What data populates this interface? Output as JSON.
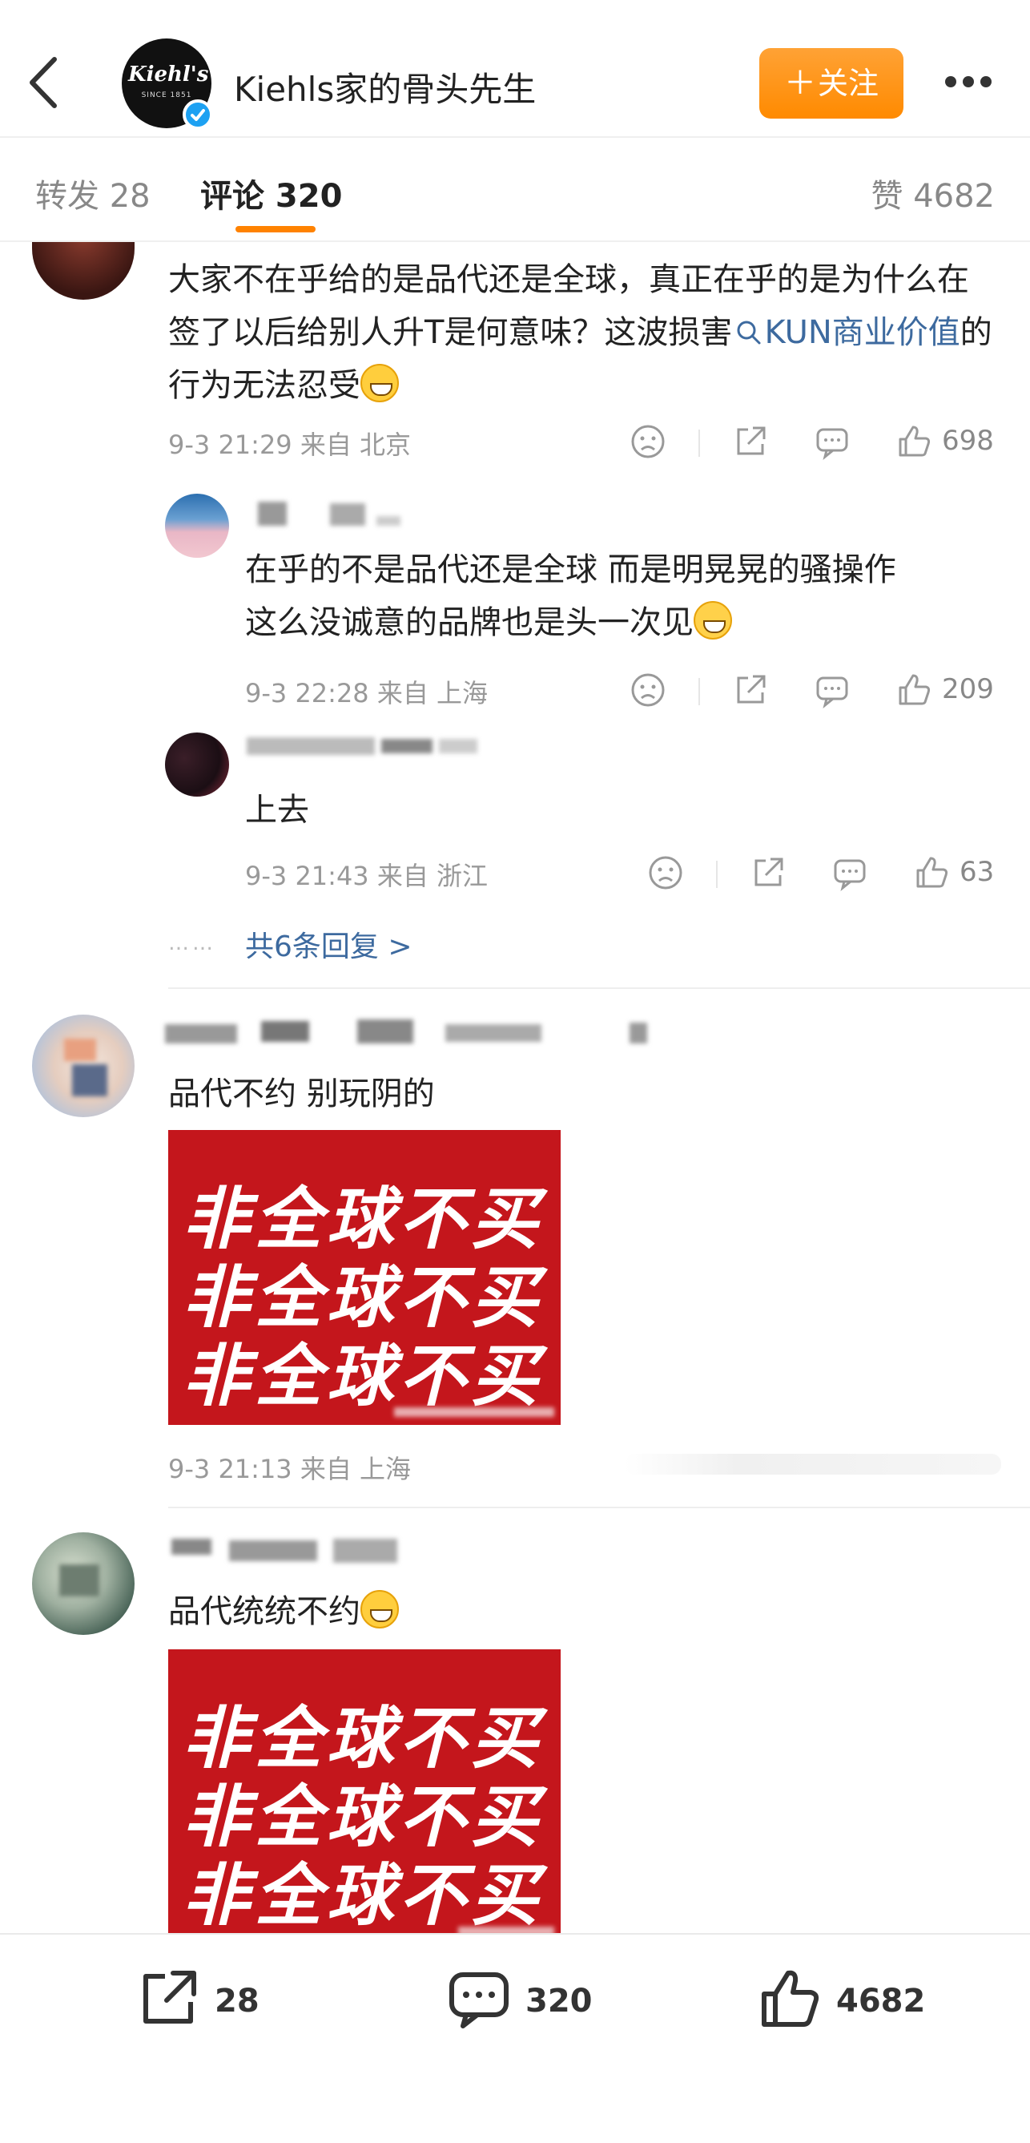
{
  "header": {
    "account_name": "Kiehls家的骨头先生",
    "brand_logo_text": "Kiehl's",
    "brand_since_text": "SINCE 1851",
    "follow_label": "关注",
    "follow_plus": "＋"
  },
  "tabs": {
    "repost": "转发 28",
    "comments": "评论 320",
    "likes": "赞 4682"
  },
  "comments": [
    {
      "text_before_topic": "大家不在乎给的是品代还是全球，真正在乎的是为什么在签了以后给别人升T是何意味？这波损害",
      "topic_link": "KUN商业价值",
      "text_after_topic": "的行为无法忍受",
      "meta": "9-3 21:29 来自 北京",
      "likes": "698",
      "replies": [
        {
          "text_line1": "在乎的不是品代还是全球 而是明晃晃的骚操作",
          "text_line2": "这么没诚意的品牌也是头一次见",
          "meta": "9-3 22:28 来自 上海",
          "likes": "209"
        },
        {
          "text": "上去",
          "meta": "9-3 21:43 来自 浙江",
          "likes": "63"
        }
      ],
      "more_replies": "共6条回复 >",
      "more_dots": "……"
    },
    {
      "text": "品代不约 别玩阴的",
      "image_lines": [
        "非全球不买",
        "非全球不买",
        "非全球不买"
      ],
      "meta": "9-3 21:13 来自 上海"
    },
    {
      "text": "品代统统不约",
      "image_lines": [
        "非全球不买",
        "非全球不买",
        "非全球不买"
      ]
    }
  ],
  "bottom_bar": {
    "reposts": "28",
    "comments": "320",
    "likes": "4682"
  },
  "colors": {
    "accent_orange": "#ff8200",
    "link_blue": "#3d6a9f",
    "poster_red": "#c4161c",
    "verified_blue": "#1da1f2"
  }
}
